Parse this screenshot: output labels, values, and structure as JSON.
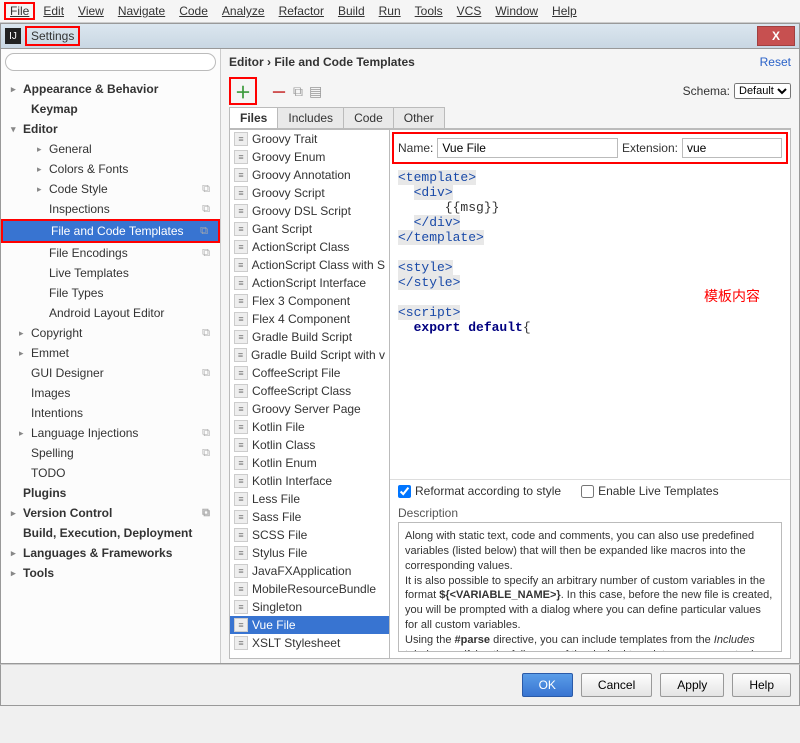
{
  "menu": [
    "File",
    "Edit",
    "View",
    "Navigate",
    "Code",
    "Analyze",
    "Refactor",
    "Build",
    "Run",
    "Tools",
    "VCS",
    "Window",
    "Help"
  ],
  "dialog_title": "Settings",
  "close": "X",
  "search_placeholder": "",
  "tree": [
    {
      "l": "Appearance & Behavior",
      "d": 0,
      "b": 1,
      "c": "r"
    },
    {
      "l": "Keymap",
      "d": 1,
      "b": 1
    },
    {
      "l": "Editor",
      "d": 0,
      "b": 1,
      "c": "d"
    },
    {
      "l": "General",
      "d": 2,
      "c": "r"
    },
    {
      "l": "Colors & Fonts",
      "d": 2,
      "c": "r"
    },
    {
      "l": "Code Style",
      "d": 2,
      "c": "r",
      "cp": 1
    },
    {
      "l": "Inspections",
      "d": 2,
      "cp": 1
    },
    {
      "l": "File and Code Templates",
      "d": 2,
      "sel": 1,
      "hl": 1,
      "cp": 1
    },
    {
      "l": "File Encodings",
      "d": 2,
      "cp": 1
    },
    {
      "l": "Live Templates",
      "d": 2
    },
    {
      "l": "File Types",
      "d": 2
    },
    {
      "l": "Android Layout Editor",
      "d": 2
    },
    {
      "l": "Copyright",
      "d": 1,
      "c": "r",
      "cp": 1
    },
    {
      "l": "Emmet",
      "d": 1,
      "c": "r"
    },
    {
      "l": "GUI Designer",
      "d": 1,
      "cp": 1
    },
    {
      "l": "Images",
      "d": 1
    },
    {
      "l": "Intentions",
      "d": 1
    },
    {
      "l": "Language Injections",
      "d": 1,
      "c": "r",
      "cp": 1
    },
    {
      "l": "Spelling",
      "d": 1,
      "cp": 1
    },
    {
      "l": "TODO",
      "d": 1
    },
    {
      "l": "Plugins",
      "d": 0,
      "b": 1
    },
    {
      "l": "Version Control",
      "d": 0,
      "b": 1,
      "c": "r",
      "cp": 1
    },
    {
      "l": "Build, Execution, Deployment",
      "d": 0,
      "b": 1
    },
    {
      "l": "Languages & Frameworks",
      "d": 0,
      "b": 1,
      "c": "r"
    },
    {
      "l": "Tools",
      "d": 0,
      "b": 1,
      "c": "r"
    }
  ],
  "breadcrumb": "Editor › File and Code Templates",
  "reset": "Reset",
  "schema_label": "Schema:",
  "schema_value": "Default",
  "tabs": [
    "Files",
    "Includes",
    "Code",
    "Other"
  ],
  "active_tab": 0,
  "templates": [
    "Groovy Trait",
    "Groovy Enum",
    "Groovy Annotation",
    "Groovy Script",
    "Groovy DSL Script",
    "Gant Script",
    "ActionScript Class",
    "ActionScript Class with S",
    "ActionScript Interface",
    "Flex 3 Component",
    "Flex 4 Component",
    "Gradle Build Script",
    "Gradle Build Script with v",
    "CoffeeScript File",
    "CoffeeScript Class",
    "Groovy Server Page",
    "Kotlin File",
    "Kotlin Class",
    "Kotlin Enum",
    "Kotlin Interface",
    "Less File",
    "Sass File",
    "SCSS File",
    "Stylus File",
    "JavaFXApplication",
    "MobileResourceBundle",
    "Singleton",
    "Vue File",
    "XSLT Stylesheet"
  ],
  "selected_template": 27,
  "name_label": "Name:",
  "name_value": "Vue File",
  "ext_label": "Extension:",
  "ext_value": "vue",
  "annotation": "模板内容",
  "reformat_label": "Reformat according to style",
  "reformat_checked": true,
  "live_label": "Enable Live Templates",
  "live_checked": false,
  "desc_label": "Description",
  "buttons": {
    "ok": "OK",
    "cancel": "Cancel",
    "apply": "Apply",
    "help": "Help"
  }
}
